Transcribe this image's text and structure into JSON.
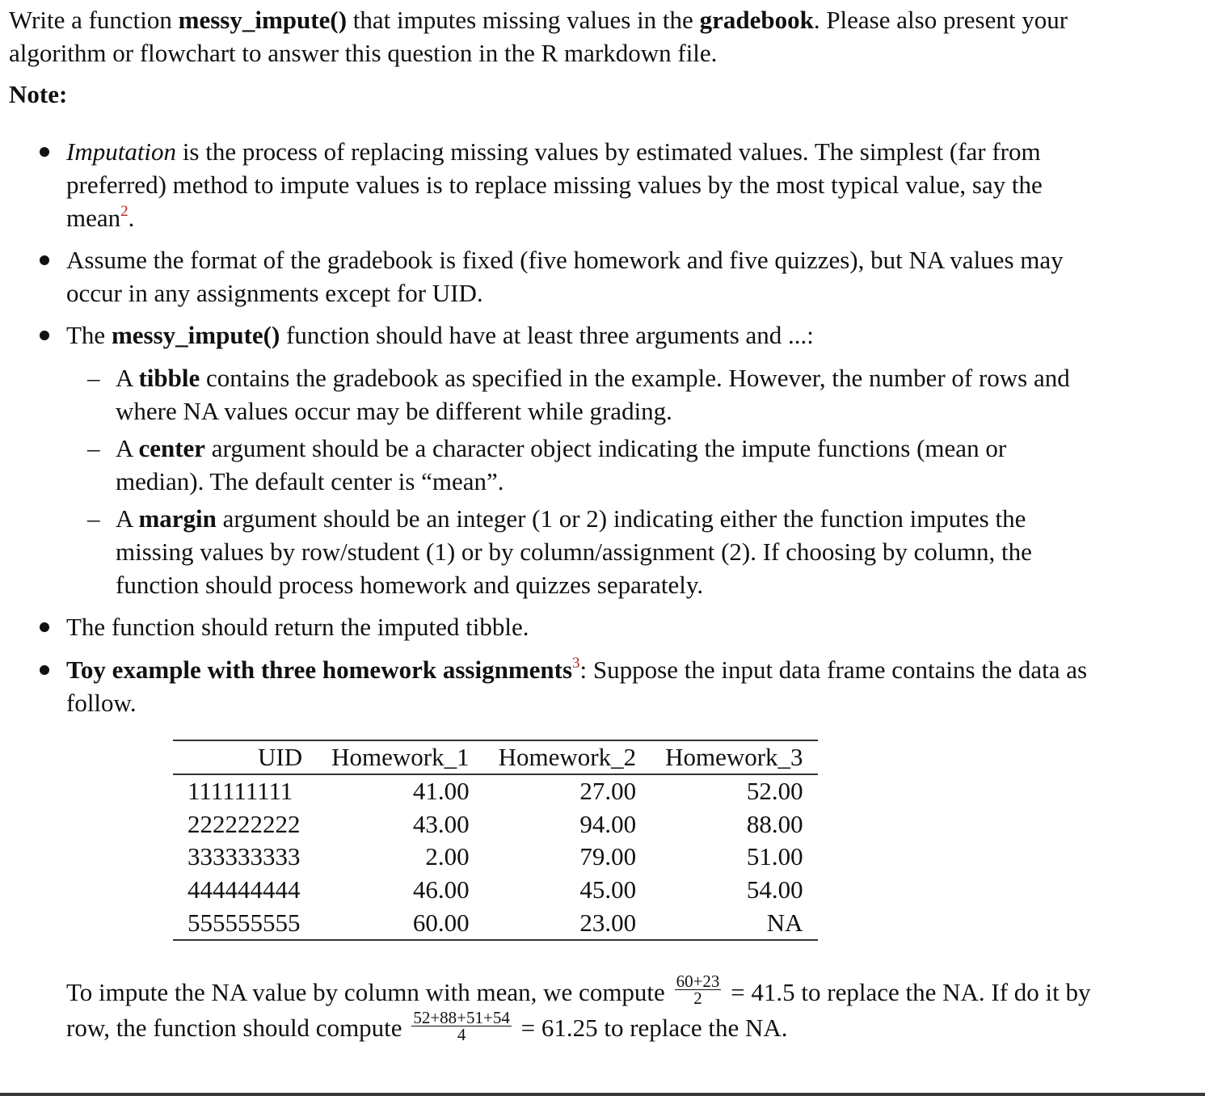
{
  "intro": {
    "t1": "Write a function ",
    "fn_name": "messy_impute()",
    "t2": " that imputes missing values in the ",
    "gradebook": "gradebook",
    "t3": ". Please also present your algorithm or flowchart to answer this question in the R markdown file."
  },
  "note_heading": "Note:",
  "bullets": {
    "imputation": {
      "term": "Imputation",
      "t1": " is the process of replacing missing values by estimated values. The simplest (far from preferred) method to impute values is to replace missing values by the most typical value, say the mean",
      "footnote": "2",
      "t2": "."
    },
    "format": {
      "text": "Assume the format of the gradebook is fixed (five homework and five quizzes), but NA values may occur in any assignments except for UID."
    },
    "arguments": {
      "t1": "The ",
      "fn_name": "messy_impute()",
      "t2": " function should have at least three arguments and ...:",
      "sub": {
        "tibble": {
          "t1": "A ",
          "term": "tibble",
          "t2": " contains the gradebook as specified in the example. However, the number of rows and where NA values occur may be different while grading."
        },
        "center": {
          "t1": "A ",
          "term": "center",
          "t2": " argument should be a character object indicating the impute functions (mean or median). The default center is “mean”."
        },
        "margin": {
          "t1": "A ",
          "term": "margin",
          "t2": " argument should be an integer (1 or 2) indicating either the function imputes the missing values by row/student (1) or by column/assignment (2). If choosing by column, the function should process homework and quizzes separately."
        }
      },
      "dash": "–"
    },
    "return": {
      "text": "The function should return the imputed tibble."
    },
    "toy": {
      "term": "Toy example with three homework assignments",
      "footnote": "3",
      "t1": ": Suppose the input data frame contains the data as follow."
    }
  },
  "table": {
    "headers": [
      "UID",
      "Homework_1",
      "Homework_2",
      "Homework_3"
    ],
    "rows": [
      [
        "111111111",
        "41.00",
        "27.00",
        "52.00"
      ],
      [
        "222222222",
        "43.00",
        "94.00",
        "88.00"
      ],
      [
        "333333333",
        "2.00",
        "79.00",
        "51.00"
      ],
      [
        "444444444",
        "46.00",
        "45.00",
        "54.00"
      ],
      [
        "555555555",
        "60.00",
        "23.00",
        "NA"
      ]
    ]
  },
  "example": {
    "t1": "To impute the NA value by column with mean, we compute ",
    "frac1_num": "60+23",
    "frac1_den": "2",
    "t2": " = 41.5 to replace the NA. If do it by row, the function should compute ",
    "frac2_num": "52+88+51+54",
    "frac2_den": "4",
    "t3": " = 61.25 to replace the NA."
  },
  "colors": {
    "footnote": "#b22222",
    "text": "#111111",
    "rule": "#3a3a3a"
  }
}
